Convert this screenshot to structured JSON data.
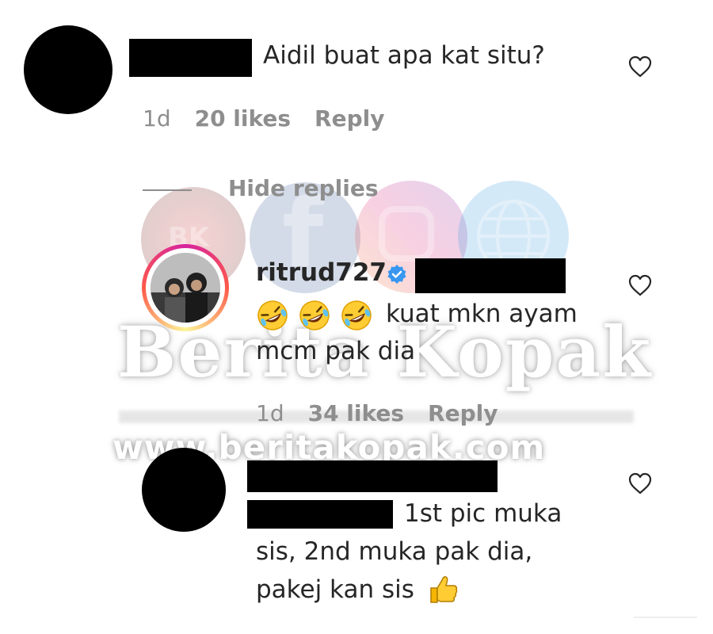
{
  "comments": [
    {
      "text": "Aidil buat apa kat situ?",
      "time": "1d",
      "likes": "20 likes",
      "reply_label": "Reply"
    }
  ],
  "replies_toggle": {
    "label": "Hide replies"
  },
  "replies": [
    {
      "username": "ritrud727",
      "verified": true,
      "text_line1": "kuat mkn ayam",
      "text_line2": "mcm pak dia",
      "emojis": [
        "rolling-on-floor-laughing-emoji",
        "rolling-on-floor-laughing-emoji",
        "rolling-on-floor-laughing-emoji"
      ],
      "time": "1d",
      "likes": "34 likes",
      "reply_label": "Reply"
    },
    {
      "text_line1": "1st pic muka",
      "text_line2": "sis, 2nd muka pak dia,",
      "text_line3": "pakej kan sis",
      "trailing_emoji": "thumbs-up-emoji"
    }
  ],
  "watermark": {
    "brand": "Berita Kopak",
    "url": "www.beritakopak.com",
    "logo_text": "BK"
  },
  "icons": {
    "like": "heart-outline-icon",
    "verified": "verified-badge-icon"
  },
  "colors": {
    "text": "#262626",
    "meta": "#8e8e8e",
    "verified": "#3897f0",
    "redaction": "#000000"
  }
}
